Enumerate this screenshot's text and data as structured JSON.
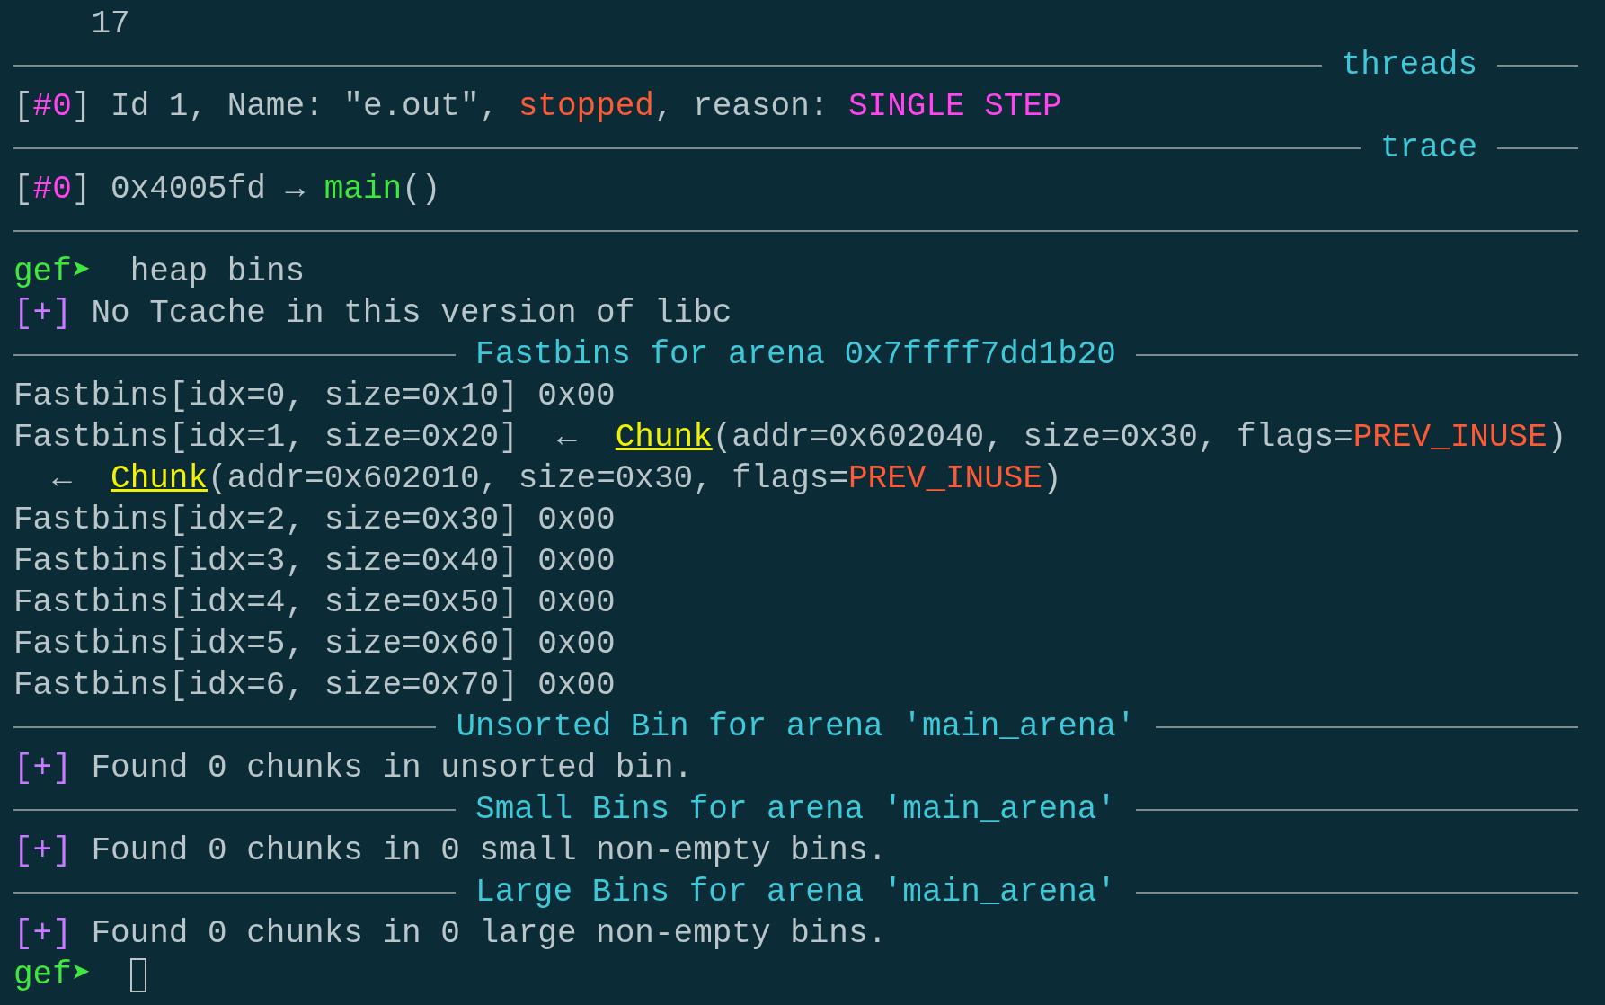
{
  "terminal": {
    "lines": [
      {
        "kind": "text",
        "segments": [
          {
            "kind": "plain",
            "text": "    17"
          }
        ]
      },
      {
        "kind": "header-right",
        "title": "threads"
      },
      {
        "kind": "text",
        "segments": [
          {
            "kind": "plain",
            "text": "["
          },
          {
            "kind": "magenta",
            "text": "#0"
          },
          {
            "kind": "plain",
            "text": "] Id 1, Name: \"e.out\", "
          },
          {
            "kind": "red",
            "text": "stopped"
          },
          {
            "kind": "plain",
            "text": ", reason: "
          },
          {
            "kind": "magenta",
            "text": "SINGLE STEP"
          }
        ]
      },
      {
        "kind": "header-right",
        "title": "trace"
      },
      {
        "kind": "text",
        "segments": [
          {
            "kind": "plain",
            "text": "["
          },
          {
            "kind": "magenta",
            "text": "#0"
          },
          {
            "kind": "plain",
            "text": "] 0x4005fd → "
          },
          {
            "kind": "green",
            "text": "main"
          },
          {
            "kind": "plain",
            "text": "()"
          }
        ]
      },
      {
        "kind": "rule"
      },
      {
        "kind": "text",
        "segments": [
          {
            "kind": "green",
            "text": "gef➤"
          },
          {
            "kind": "plain",
            "text": "  heap bins"
          }
        ]
      },
      {
        "kind": "text",
        "segments": [
          {
            "kind": "purple",
            "text": "[+]"
          },
          {
            "kind": "plain",
            "text": " No Tcache in this version of libc"
          }
        ]
      },
      {
        "kind": "header-center",
        "title": "Fastbins for arena 0x7ffff7dd1b20"
      },
      {
        "kind": "text",
        "segments": [
          {
            "kind": "plain",
            "text": "Fastbins[idx=0, size=0x10] 0x00"
          }
        ]
      },
      {
        "kind": "text",
        "segments": [
          {
            "kind": "plain",
            "text": "Fastbins[idx=1, size=0x20]  ←  "
          },
          {
            "kind": "yellow-underline",
            "text": "Chunk"
          },
          {
            "kind": "plain",
            "text": "(addr=0x602040, size=0x30, flags="
          },
          {
            "kind": "red",
            "text": "PREV_INUSE"
          },
          {
            "kind": "plain",
            "text": ")"
          }
        ]
      },
      {
        "kind": "text",
        "segments": [
          {
            "kind": "plain",
            "text": "  ←  "
          },
          {
            "kind": "yellow-underline",
            "text": "Chunk"
          },
          {
            "kind": "plain",
            "text": "(addr=0x602010, size=0x30, flags="
          },
          {
            "kind": "red",
            "text": "PREV_INUSE"
          },
          {
            "kind": "plain",
            "text": ")"
          }
        ]
      },
      {
        "kind": "text",
        "segments": [
          {
            "kind": "plain",
            "text": "Fastbins[idx=2, size=0x30] 0x00"
          }
        ]
      },
      {
        "kind": "text",
        "segments": [
          {
            "kind": "plain",
            "text": "Fastbins[idx=3, size=0x40] 0x00"
          }
        ]
      },
      {
        "kind": "text",
        "segments": [
          {
            "kind": "plain",
            "text": "Fastbins[idx=4, size=0x50] 0x00"
          }
        ]
      },
      {
        "kind": "text",
        "segments": [
          {
            "kind": "plain",
            "text": "Fastbins[idx=5, size=0x60] 0x00"
          }
        ]
      },
      {
        "kind": "text",
        "segments": [
          {
            "kind": "plain",
            "text": "Fastbins[idx=6, size=0x70] 0x00"
          }
        ]
      },
      {
        "kind": "header-center",
        "title": "Unsorted Bin for arena 'main_arena'"
      },
      {
        "kind": "text",
        "segments": [
          {
            "kind": "purple",
            "text": "[+]"
          },
          {
            "kind": "plain",
            "text": " Found 0 chunks in unsorted bin."
          }
        ]
      },
      {
        "kind": "header-center",
        "title": "Small Bins for arena 'main_arena'"
      },
      {
        "kind": "text",
        "segments": [
          {
            "kind": "purple",
            "text": "[+]"
          },
          {
            "kind": "plain",
            "text": " Found 0 chunks in 0 small non-empty bins."
          }
        ]
      },
      {
        "kind": "header-center",
        "title": "Large Bins for arena 'main_arena'"
      },
      {
        "kind": "text",
        "segments": [
          {
            "kind": "purple",
            "text": "[+]"
          },
          {
            "kind": "plain",
            "text": " Found 0 chunks in 0 large non-empty bins."
          }
        ]
      },
      {
        "kind": "prompt",
        "prompt": "gef➤"
      }
    ]
  }
}
